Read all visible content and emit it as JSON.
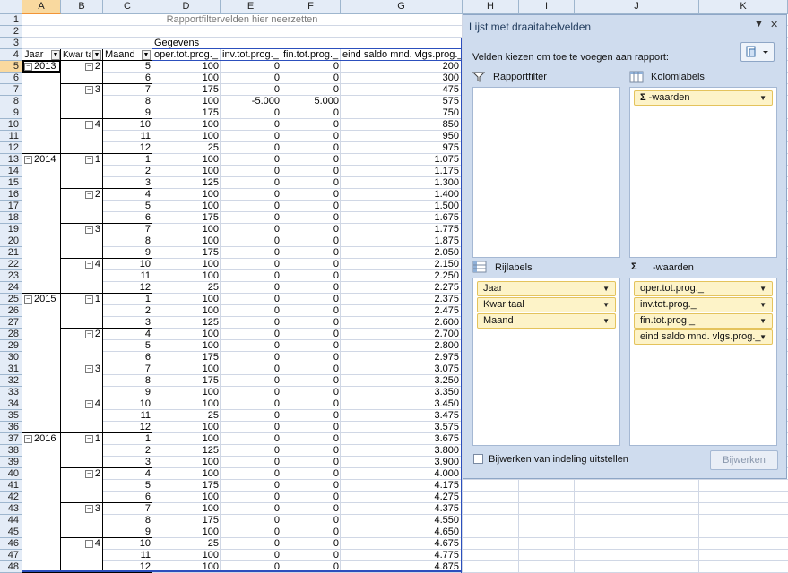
{
  "sheet": {
    "columns": [
      "A",
      "B",
      "C",
      "D",
      "E",
      "F",
      "G",
      "H",
      "I",
      "J",
      "K"
    ],
    "rows": [
      "1",
      "2",
      "3",
      "4",
      "5",
      "6",
      "7",
      "8",
      "9",
      "10",
      "11",
      "12",
      "13",
      "14",
      "15",
      "16",
      "17",
      "18",
      "19",
      "20",
      "21",
      "22",
      "23",
      "24",
      "25",
      "26",
      "27",
      "28",
      "29",
      "30",
      "31",
      "32",
      "33",
      "34",
      "35",
      "36",
      "37",
      "38",
      "39",
      "40",
      "41",
      "42",
      "43",
      "44",
      "45",
      "46",
      "47",
      "48"
    ],
    "filter_drop_text": "Rapportfiltervelden hier neerzetten",
    "gegevens": "Gegevens",
    "headers": {
      "jaar": "Jaar",
      "kwartaal": "Kwar taal",
      "maand": "Maand",
      "oper": "oper.tot.prog._",
      "inv": "inv.tot.prog._",
      "fin": "fin.tot.prog._",
      "eind": "eind saldo mnd. vlgs.prog._"
    },
    "data_rows": [
      {
        "jaar": "2013",
        "kw": "2",
        "m": "5",
        "d": "100",
        "e": "0",
        "f": "0",
        "g": "200"
      },
      {
        "jaar": "",
        "kw": "",
        "m": "6",
        "d": "100",
        "e": "0",
        "f": "0",
        "g": "300"
      },
      {
        "jaar": "",
        "kw": "3",
        "m": "7",
        "d": "175",
        "e": "0",
        "f": "0",
        "g": "475"
      },
      {
        "jaar": "",
        "kw": "",
        "m": "8",
        "d": "100",
        "e": "-5.000",
        "f": "5.000",
        "g": "575"
      },
      {
        "jaar": "",
        "kw": "",
        "m": "9",
        "d": "175",
        "e": "0",
        "f": "0",
        "g": "750"
      },
      {
        "jaar": "",
        "kw": "4",
        "m": "10",
        "d": "100",
        "e": "0",
        "f": "0",
        "g": "850"
      },
      {
        "jaar": "",
        "kw": "",
        "m": "11",
        "d": "100",
        "e": "0",
        "f": "0",
        "g": "950"
      },
      {
        "jaar": "",
        "kw": "",
        "m": "12",
        "d": "25",
        "e": "0",
        "f": "0",
        "g": "975"
      },
      {
        "jaar": "2014",
        "kw": "1",
        "m": "1",
        "d": "100",
        "e": "0",
        "f": "0",
        "g": "1.075"
      },
      {
        "jaar": "",
        "kw": "",
        "m": "2",
        "d": "100",
        "e": "0",
        "f": "0",
        "g": "1.175"
      },
      {
        "jaar": "",
        "kw": "",
        "m": "3",
        "d": "125",
        "e": "0",
        "f": "0",
        "g": "1.300"
      },
      {
        "jaar": "",
        "kw": "2",
        "m": "4",
        "d": "100",
        "e": "0",
        "f": "0",
        "g": "1.400"
      },
      {
        "jaar": "",
        "kw": "",
        "m": "5",
        "d": "100",
        "e": "0",
        "f": "0",
        "g": "1.500"
      },
      {
        "jaar": "",
        "kw": "",
        "m": "6",
        "d": "175",
        "e": "0",
        "f": "0",
        "g": "1.675"
      },
      {
        "jaar": "",
        "kw": "3",
        "m": "7",
        "d": "100",
        "e": "0",
        "f": "0",
        "g": "1.775"
      },
      {
        "jaar": "",
        "kw": "",
        "m": "8",
        "d": "100",
        "e": "0",
        "f": "0",
        "g": "1.875"
      },
      {
        "jaar": "",
        "kw": "",
        "m": "9",
        "d": "175",
        "e": "0",
        "f": "0",
        "g": "2.050"
      },
      {
        "jaar": "",
        "kw": "4",
        "m": "10",
        "d": "100",
        "e": "0",
        "f": "0",
        "g": "2.150"
      },
      {
        "jaar": "",
        "kw": "",
        "m": "11",
        "d": "100",
        "e": "0",
        "f": "0",
        "g": "2.250"
      },
      {
        "jaar": "",
        "kw": "",
        "m": "12",
        "d": "25",
        "e": "0",
        "f": "0",
        "g": "2.275"
      },
      {
        "jaar": "2015",
        "kw": "1",
        "m": "1",
        "d": "100",
        "e": "0",
        "f": "0",
        "g": "2.375"
      },
      {
        "jaar": "",
        "kw": "",
        "m": "2",
        "d": "100",
        "e": "0",
        "f": "0",
        "g": "2.475"
      },
      {
        "jaar": "",
        "kw": "",
        "m": "3",
        "d": "125",
        "e": "0",
        "f": "0",
        "g": "2.600"
      },
      {
        "jaar": "",
        "kw": "2",
        "m": "4",
        "d": "100",
        "e": "0",
        "f": "0",
        "g": "2.700"
      },
      {
        "jaar": "",
        "kw": "",
        "m": "5",
        "d": "100",
        "e": "0",
        "f": "0",
        "g": "2.800"
      },
      {
        "jaar": "",
        "kw": "",
        "m": "6",
        "d": "175",
        "e": "0",
        "f": "0",
        "g": "2.975"
      },
      {
        "jaar": "",
        "kw": "3",
        "m": "7",
        "d": "100",
        "e": "0",
        "f": "0",
        "g": "3.075"
      },
      {
        "jaar": "",
        "kw": "",
        "m": "8",
        "d": "175",
        "e": "0",
        "f": "0",
        "g": "3.250"
      },
      {
        "jaar": "",
        "kw": "",
        "m": "9",
        "d": "100",
        "e": "0",
        "f": "0",
        "g": "3.350"
      },
      {
        "jaar": "",
        "kw": "4",
        "m": "10",
        "d": "100",
        "e": "0",
        "f": "0",
        "g": "3.450"
      },
      {
        "jaar": "",
        "kw": "",
        "m": "11",
        "d": "25",
        "e": "0",
        "f": "0",
        "g": "3.475"
      },
      {
        "jaar": "",
        "kw": "",
        "m": "12",
        "d": "100",
        "e": "0",
        "f": "0",
        "g": "3.575"
      },
      {
        "jaar": "2016",
        "kw": "1",
        "m": "1",
        "d": "100",
        "e": "0",
        "f": "0",
        "g": "3.675"
      },
      {
        "jaar": "",
        "kw": "",
        "m": "2",
        "d": "125",
        "e": "0",
        "f": "0",
        "g": "3.800"
      },
      {
        "jaar": "",
        "kw": "",
        "m": "3",
        "d": "100",
        "e": "0",
        "f": "0",
        "g": "3.900"
      },
      {
        "jaar": "",
        "kw": "2",
        "m": "4",
        "d": "100",
        "e": "0",
        "f": "0",
        "g": "4.000"
      },
      {
        "jaar": "",
        "kw": "",
        "m": "5",
        "d": "175",
        "e": "0",
        "f": "0",
        "g": "4.175"
      },
      {
        "jaar": "",
        "kw": "",
        "m": "6",
        "d": "100",
        "e": "0",
        "f": "0",
        "g": "4.275"
      },
      {
        "jaar": "",
        "kw": "3",
        "m": "7",
        "d": "100",
        "e": "0",
        "f": "0",
        "g": "4.375"
      },
      {
        "jaar": "",
        "kw": "",
        "m": "8",
        "d": "175",
        "e": "0",
        "f": "0",
        "g": "4.550"
      },
      {
        "jaar": "",
        "kw": "",
        "m": "9",
        "d": "100",
        "e": "0",
        "f": "0",
        "g": "4.650"
      },
      {
        "jaar": "",
        "kw": "4",
        "m": "10",
        "d": "25",
        "e": "0",
        "f": "0",
        "g": "4.675"
      },
      {
        "jaar": "",
        "kw": "",
        "m": "11",
        "d": "100",
        "e": "0",
        "f": "0",
        "g": "4.775"
      },
      {
        "jaar": "",
        "kw": "",
        "m": "12",
        "d": "100",
        "e": "0",
        "f": "0",
        "g": "4.875"
      }
    ]
  },
  "field_list": {
    "title": "Lijst met draaitabelvelden",
    "instructions": "Velden kiezen om toe te voegen aan rapport:",
    "report_filter_label": "Rapportfilter",
    "column_labels_label": "Kolomlabels",
    "row_labels_label": "Rijlabels",
    "values_label": "-waarden",
    "column_chips": [
      "-waarden"
    ],
    "row_chips": [
      "Jaar",
      "Kwar taal",
      "Maand"
    ],
    "value_chips": [
      "oper.tot.prog._",
      "inv.tot.prog._",
      "fin.tot.prog._",
      "eind saldo mnd. vlgs.prog._"
    ],
    "defer_label": "Bijwerken van indeling uitstellen",
    "update_button": "Bijwerken",
    "icons": [
      "filter-icon",
      "column-labels-icon",
      "row-labels-icon",
      "sigma-icon",
      "layout-icon",
      "close-icon"
    ]
  }
}
